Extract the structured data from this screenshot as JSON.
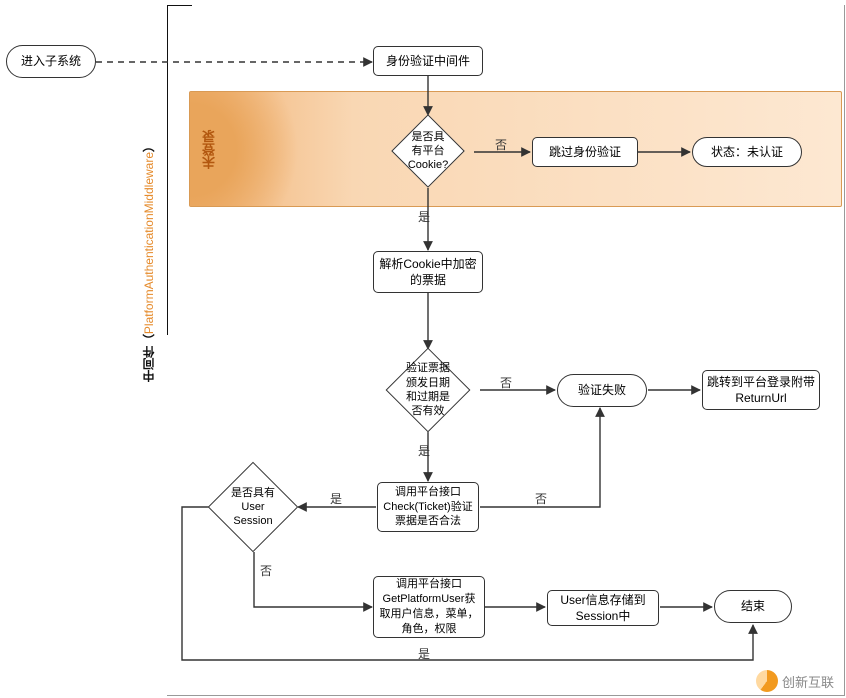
{
  "axis_label_prefix": "中间件（",
  "axis_label_orange": "PlatformAuthenticationMiddleware",
  "axis_label_suffix": "）",
  "zone_unlogged": "未登录",
  "nodes": {
    "enter": "进入子系统",
    "auth_mw": "身份验证中间件",
    "has_cookie": "是否具有平台Cookie?",
    "skip_auth": "跳过身份验证",
    "state_unauth": "状态：未认证",
    "parse_cookie": "解析Cookie中加密的票据",
    "verify_ticket": "验证票据颁发日期和过期是否有效",
    "verify_fail": "验证失败",
    "redirect_login": "跳转到平台登录附带ReturnUrl",
    "has_session": "是否具有User Session",
    "check_ticket": "调用平台接口Check(Ticket)验证票据是否合法",
    "get_user": "调用平台接口GetPlatformUser获取用户信息，菜单，角色，权限",
    "save_session": "User信息存储到Session中",
    "end": "结束"
  },
  "labels": {
    "yes": "是",
    "no": "否"
  },
  "watermark": "创新互联"
}
